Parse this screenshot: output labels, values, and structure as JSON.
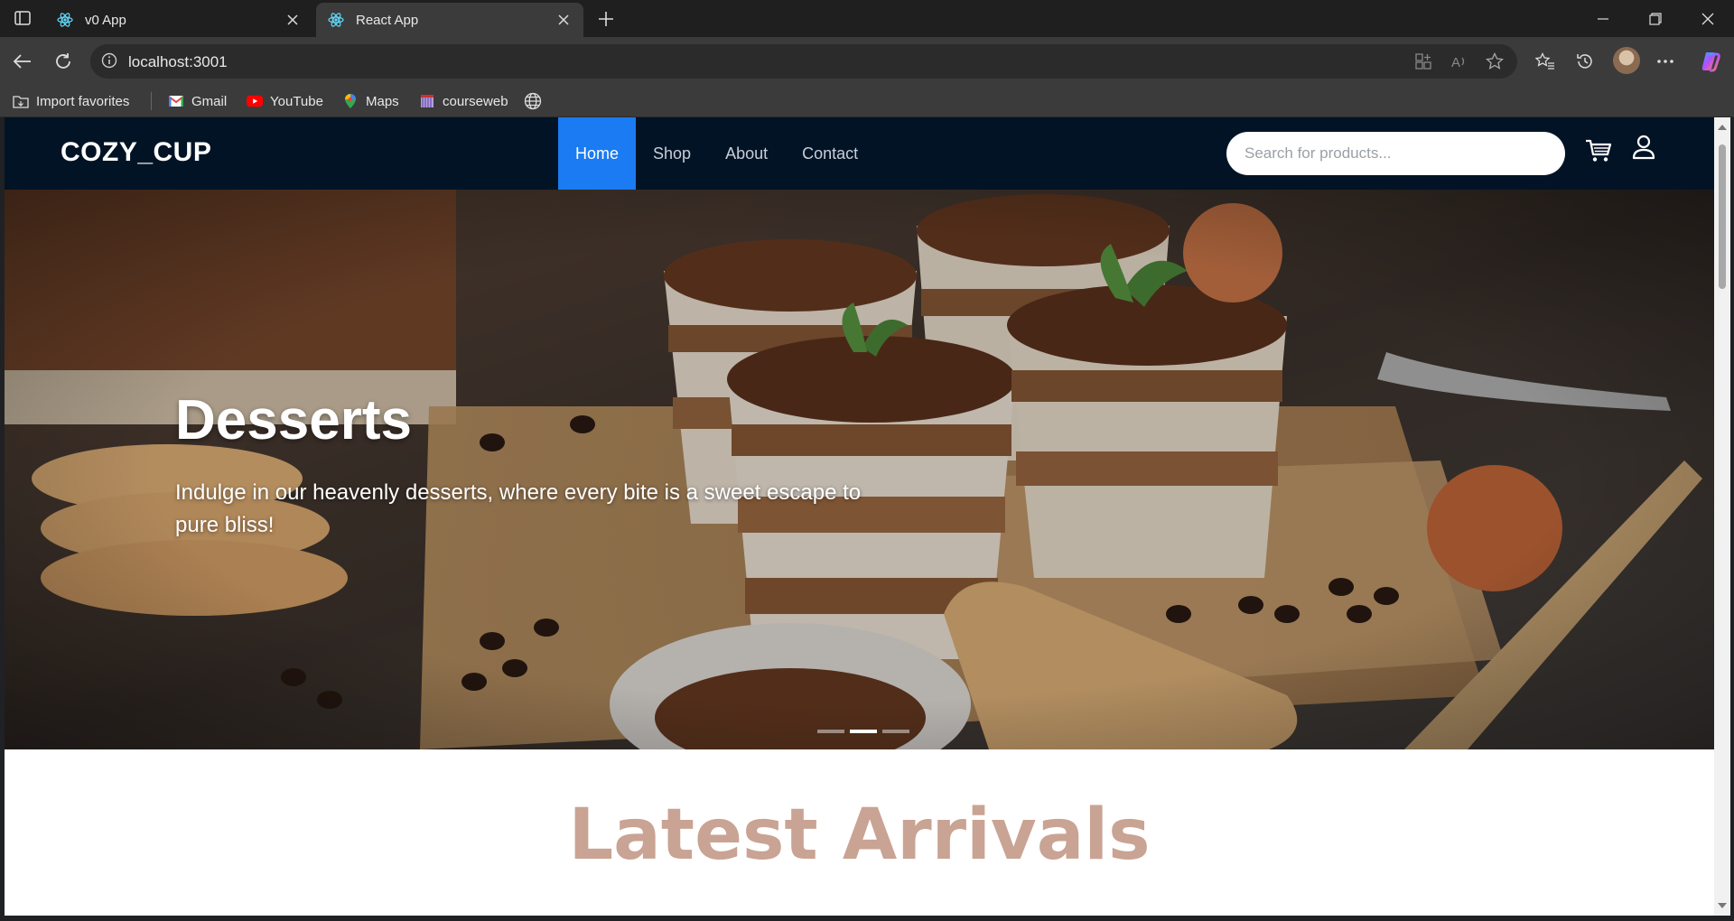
{
  "browser": {
    "tabs": [
      {
        "title": "v0 App",
        "icon": "react-icon",
        "active": false
      },
      {
        "title": "React App",
        "icon": "react-icon",
        "active": true
      }
    ],
    "url": "localhost:3001",
    "bookmarks": [
      {
        "label": "Import favorites",
        "icon": "folder-import-icon"
      },
      {
        "label": "Gmail",
        "icon": "gmail-icon"
      },
      {
        "label": "YouTube",
        "icon": "youtube-icon"
      },
      {
        "label": "Maps",
        "icon": "maps-icon"
      },
      {
        "label": "courseweb",
        "icon": "courseweb-icon"
      }
    ]
  },
  "site": {
    "logo": "COZY_CUP",
    "nav": [
      {
        "label": "Home",
        "active": true
      },
      {
        "label": "Shop",
        "active": false
      },
      {
        "label": "About",
        "active": false
      },
      {
        "label": "Contact",
        "active": false
      }
    ],
    "search_placeholder": "Search for products...",
    "colors": {
      "header_bg": "#021326",
      "active_nav": "#1a7bf2",
      "section_title": "#c9a393"
    }
  },
  "hero": {
    "title": "Desserts",
    "subtitle": "Indulge in our heavenly desserts, where every bite is a sweet escape to pure bliss!",
    "slides": 3,
    "active_slide": 2
  },
  "latest": {
    "title": "Latest Arrivals"
  }
}
